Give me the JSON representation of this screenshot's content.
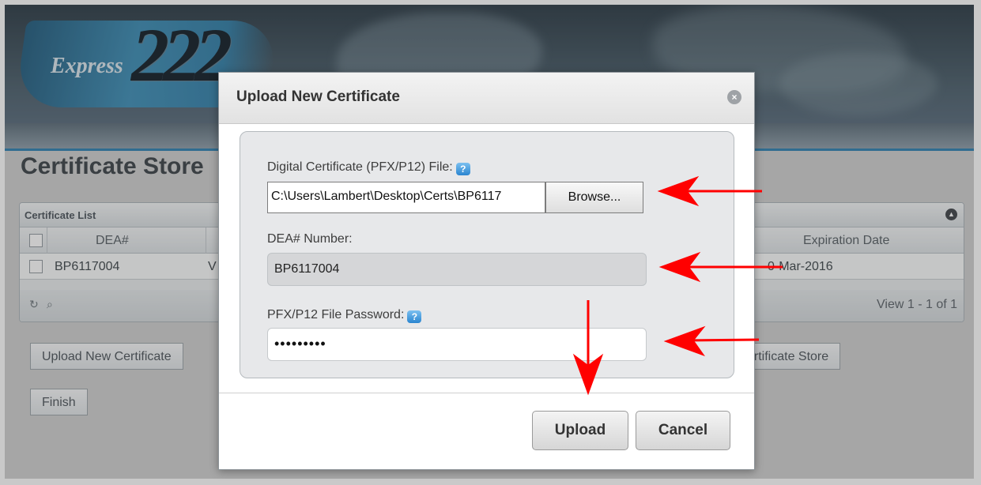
{
  "app": {
    "logo_word": "Express",
    "logo_number": "222"
  },
  "page": {
    "title": "Certificate Store"
  },
  "grid": {
    "caption": "Certificate List",
    "columns": [
      "DEA#",
      "Expiration Date"
    ],
    "rows": [
      {
        "dea": "BP6117004",
        "name_partial": "V",
        "expiration": "0-Mar-2016"
      }
    ],
    "view_text": "View 1 - 1 of 1"
  },
  "page_buttons": {
    "upload": "Upload New Certificate",
    "store": "ertificate Store",
    "finish": "Finish"
  },
  "dialog": {
    "title": "Upload New Certificate",
    "file_label": "Digital Certificate (PFX/P12) File:",
    "file_value": "C:\\Users\\Lambert\\Desktop\\Certs\\BP6117",
    "browse_label": "Browse...",
    "dea_label": "DEA# Number:",
    "dea_value": "BP6117004",
    "password_label": "PFX/P12 File Password:",
    "password_mask": "•••••••••",
    "upload_label": "Upload",
    "cancel_label": "Cancel",
    "help_glyph": "?",
    "close_glyph": "×"
  },
  "colors": {
    "arrow": "#ff0000",
    "accent": "#2b7fb0"
  }
}
